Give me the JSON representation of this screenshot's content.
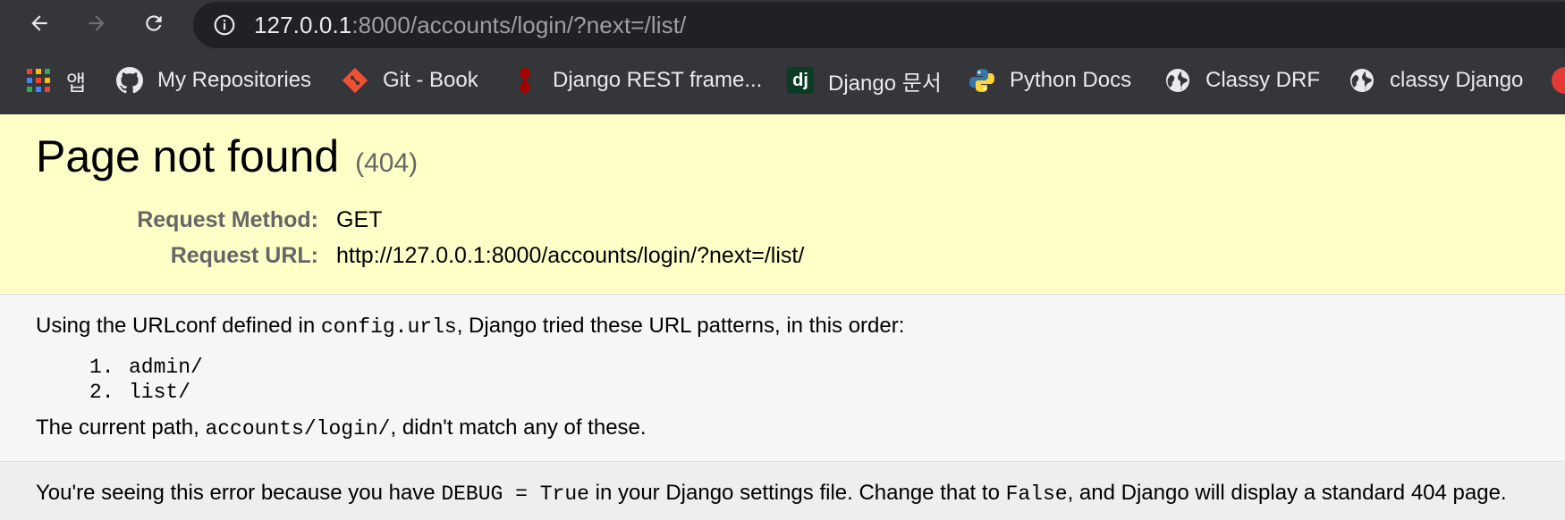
{
  "browser": {
    "url_host": "127.0.0.1",
    "url_rest": ":8000/accounts/login/?next=/list/",
    "bookmarks": [
      {
        "label": "앱",
        "icon": "apps-grid-icon"
      },
      {
        "label": "My Repositories",
        "icon": "github-icon"
      },
      {
        "label": "Git - Book",
        "icon": "git-icon"
      },
      {
        "label": "Django REST frame...",
        "icon": "drf-icon"
      },
      {
        "label": "Django 문서",
        "icon": "django-icon"
      },
      {
        "label": "Python Docs",
        "icon": "python-icon"
      },
      {
        "label": "Classy DRF",
        "icon": "globe-icon"
      },
      {
        "label": "classy Django",
        "icon": "globe-icon"
      }
    ]
  },
  "summary": {
    "title": "Page not found",
    "code": "(404)",
    "method_label": "Request Method:",
    "method_value": "GET",
    "url_label": "Request URL:",
    "url_value": "http://127.0.0.1:8000/accounts/login/?next=/list/"
  },
  "info": {
    "line1_pre": "Using the URLconf defined in ",
    "line1_code": "config.urls",
    "line1_post": ", Django tried these URL patterns, in this order:",
    "patterns": [
      {
        "num": "1.",
        "value": "admin/"
      },
      {
        "num": "2.",
        "value": "list/"
      }
    ],
    "line2_pre": "The current path, ",
    "line2_code": "accounts/login/",
    "line2_post": ", didn't match any of these."
  },
  "explanation": {
    "pre": "You're seeing this error because you have ",
    "code1": "DEBUG = True",
    "mid": " in your Django settings file. Change that to ",
    "code2": "False",
    "post": ", and Django will display a standard 404 page."
  },
  "colors": {
    "chrome_bg": "#35363a",
    "omnibox_bg": "#202124",
    "summary_bg": "#ffffc8",
    "info_bg": "#f6f6f6",
    "explanation_bg": "#eeeeee"
  }
}
